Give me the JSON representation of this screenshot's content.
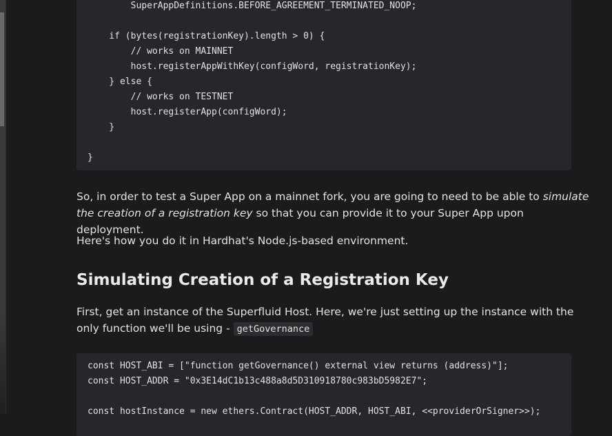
{
  "code_block_1": {
    "lines": [
      "        SuperAppDefinitions.BEFORE_AGREEMENT_TERMINATED_NOOP;",
      "",
      "    if (bytes(registrationKey).length > 0) {",
      "        // works on MAINNET",
      "        host.registerAppWithKey(configWord, registrationKey);",
      "    } else {",
      "        // works on TESTNET",
      "        host.registerApp(configWord);",
      "    }",
      "",
      "}"
    ]
  },
  "paragraph_1": {
    "before": "So, in order to test a Super App on a mainnet fork, you are going to need to be able to ",
    "emphasis": "simulate the creation of a registration key",
    "after": " so that you can provide it to your Super App upon deployment."
  },
  "paragraph_2": "Here's how you do it in Hardhat's Node.js-based environment.",
  "heading": "Simulating Creation of a Registration Key",
  "paragraph_3": {
    "text": "First, get an instance of the Superfluid Host. Here, we're just setting up the instance with the only function we'll be using - ",
    "code": "getGovernance"
  },
  "code_block_2": {
    "lines": [
      "const HOST_ABI = [\"function getGovernance() external view returns (address)\"];",
      "const HOST_ADDR = \"0x3E14dC1b13c488a8d5D310918780c983bD5982E7\";",
      "",
      "const hostInstance = new ethers.Contract(HOST_ADDR, HOST_ABI, <<providerOrSigner>>);"
    ]
  }
}
